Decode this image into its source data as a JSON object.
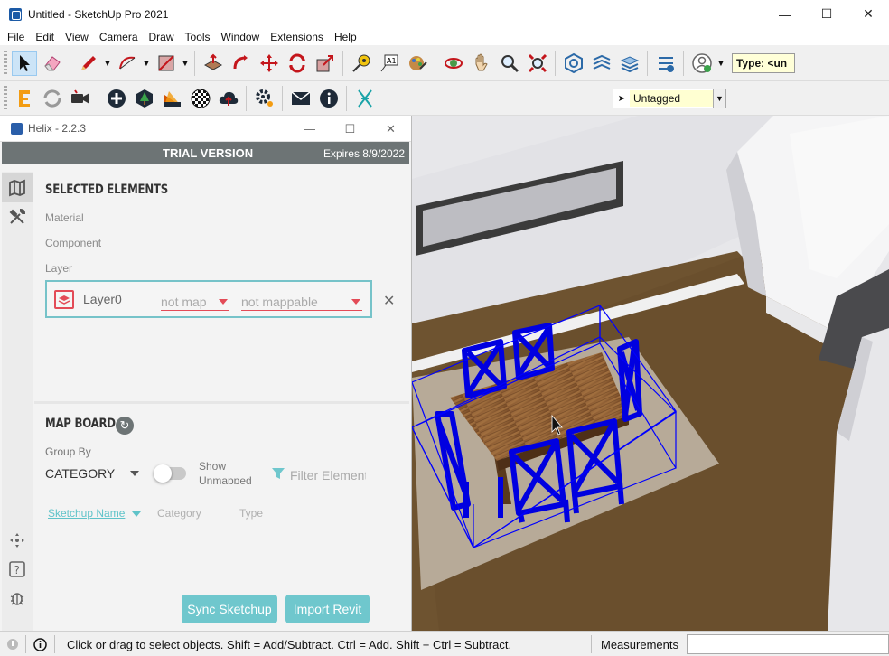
{
  "window": {
    "title": "Untitled - SketchUp Pro 2021",
    "minimize": "—",
    "maximize": "☐",
    "close": "✕"
  },
  "menu": [
    "File",
    "Edit",
    "View",
    "Camera",
    "Draw",
    "Tools",
    "Window",
    "Extensions",
    "Help"
  ],
  "toolbar": {
    "type_box": "Type: <un"
  },
  "tag_selector": {
    "value": "Untagged"
  },
  "helix": {
    "title": "Helix - 2.2.3",
    "trial_label": "TRIAL VERSION",
    "expires": "Expires 8/9/2022",
    "selected_elements": {
      "heading": "SELECTED ELEMENTS",
      "material_label": "Material",
      "component_label": "Component",
      "layer_label": "Layer",
      "layer_name": "Layer0",
      "map_select": "not map",
      "mappable_select": "not mappable",
      "remove": "✕"
    },
    "map_board": {
      "heading": "MAP BOARD",
      "group_by_label": "Group By",
      "group_by_value": "CATEGORY",
      "show_unmapped": "Show Unmapped",
      "filter_placeholder": "Filter Elements",
      "columns": [
        "Sketchup Name",
        "Category",
        "Type"
      ],
      "sync_button": "Sync Sketchup",
      "import_button": "Import Revit"
    },
    "colors": {
      "accent": "#6fc7cd",
      "warn": "#e34b57",
      "header": "#6d7475"
    }
  },
  "status": {
    "message": "Click or drag to select objects. Shift = Add/Subtract. Ctrl = Add. Shift + Ctrl = Subtract.",
    "measurements_label": "Measurements"
  }
}
